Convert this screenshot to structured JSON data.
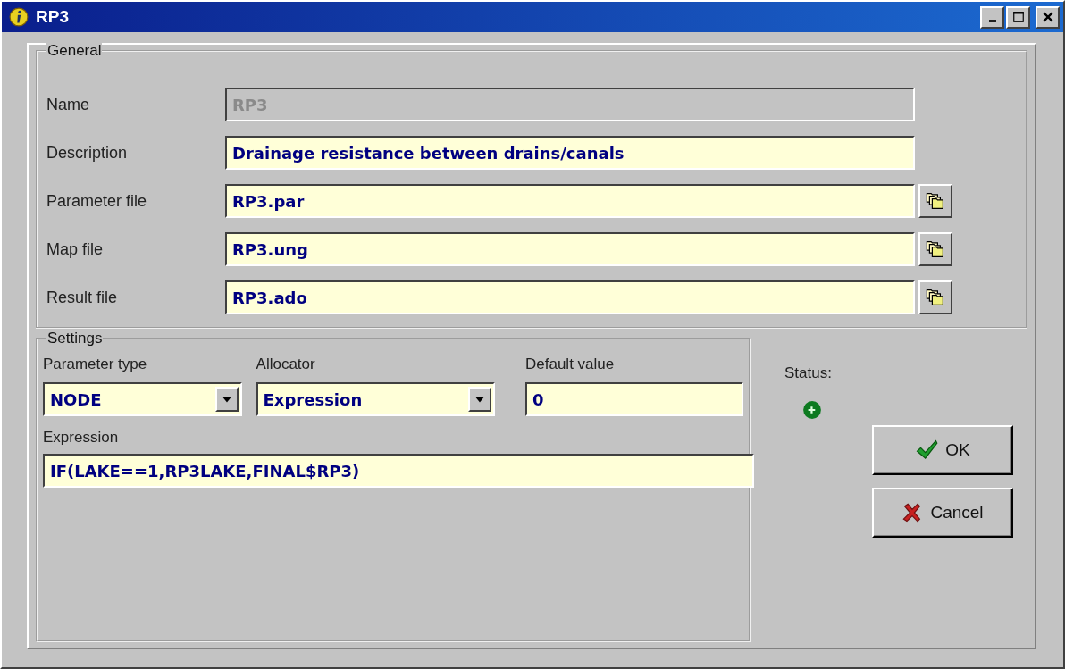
{
  "window": {
    "title": "RP3"
  },
  "general": {
    "legend": "General",
    "fields": [
      {
        "label": "Name",
        "value": "RP3",
        "disabled": true,
        "browse": false
      },
      {
        "label": "Description",
        "value": "Drainage resistance between drains/canals",
        "disabled": false,
        "browse": false
      },
      {
        "label": "Parameter file",
        "value": "RP3.par",
        "disabled": false,
        "browse": true
      },
      {
        "label": "Map file",
        "value": "RP3.ung",
        "disabled": false,
        "browse": true
      },
      {
        "label": "Result file",
        "value": "RP3.ado",
        "disabled": false,
        "browse": true
      }
    ]
  },
  "settings": {
    "legend": "Settings",
    "parameter_type": {
      "label": "Parameter type",
      "value": "NODE"
    },
    "allocator": {
      "label": "Allocator",
      "value": "Expression"
    },
    "default_value": {
      "label": "Default value",
      "value": "0"
    },
    "expression": {
      "label": "Expression",
      "value": "IF(LAKE==1,RP3LAKE,FINAL$RP3)"
    }
  },
  "status": {
    "label": "Status:"
  },
  "buttons": [
    {
      "kind": "ok",
      "label": "OK"
    },
    {
      "kind": "cancel",
      "label": "Cancel"
    }
  ]
}
